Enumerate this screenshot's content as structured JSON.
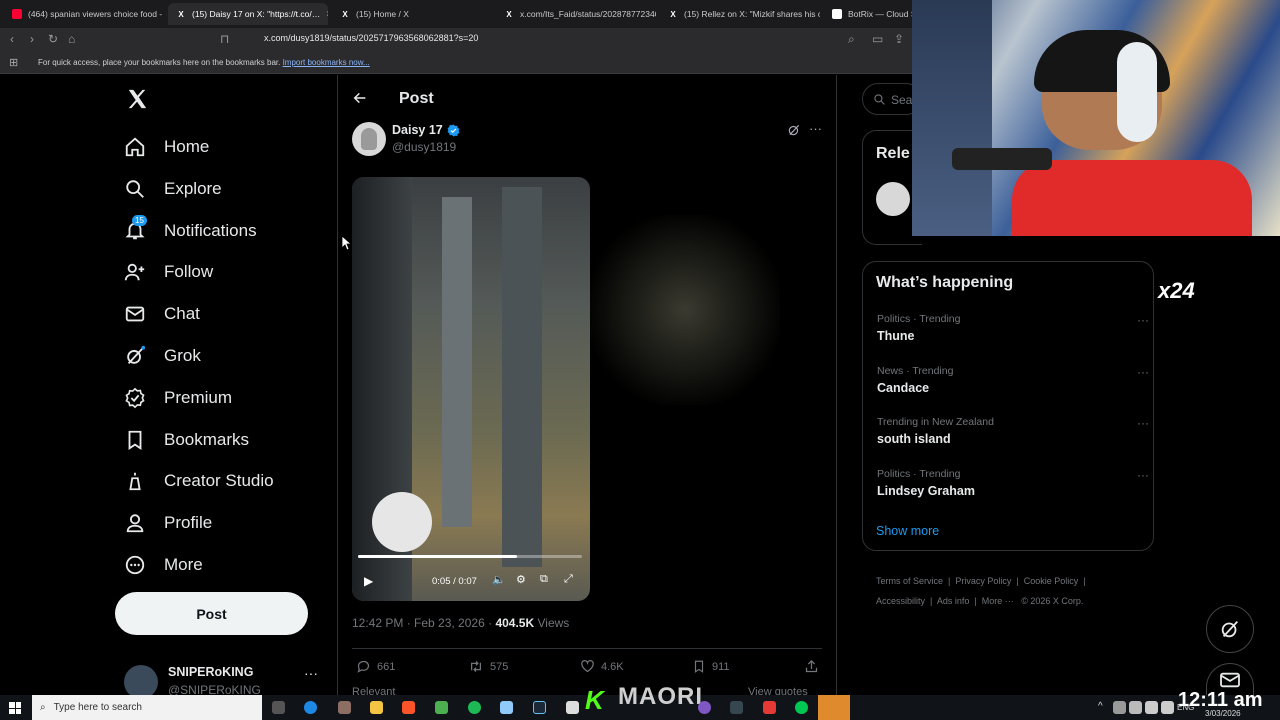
{
  "browser": {
    "tabs": [
      {
        "title": "(464) spanian viewers choice food - …",
        "fav_color": "#ff0033"
      },
      {
        "title": "(15) Daisy 17 on X: \"https://t.co/…",
        "fav_color": "#000000"
      },
      {
        "title": "(15) Home / X",
        "fav_color": "#000000"
      },
      {
        "title": "x.com/Its_Faid/status/202878772346…",
        "fav_color": "#000000"
      },
      {
        "title": "(15) Rellez on X: \"Mizkif shares his o…",
        "fav_color": "#000000"
      },
      {
        "title": "BotRix — Cloud St…",
        "fav_color": "#ffffff"
      }
    ],
    "close_glyph": "×",
    "url": "x.com/dusy1819/status/2025717963568062881?s=20",
    "bookmarks_hint": "For quick access, place your bookmarks here on the bookmarks bar.",
    "bookmarks_link": "Import bookmarks now..."
  },
  "sidebar": {
    "items": [
      {
        "label": "Home",
        "icon": "home-icon"
      },
      {
        "label": "Explore",
        "icon": "search-icon"
      },
      {
        "label": "Notifications",
        "icon": "bell-icon",
        "badge": "15"
      },
      {
        "label": "Follow",
        "icon": "follow-icon"
      },
      {
        "label": "Chat",
        "icon": "mail-icon"
      },
      {
        "label": "Grok",
        "icon": "grok-icon"
      },
      {
        "label": "Premium",
        "icon": "verified-icon"
      },
      {
        "label": "Bookmarks",
        "icon": "bookmark-icon"
      },
      {
        "label": "Creator Studio",
        "icon": "creator-icon"
      },
      {
        "label": "Profile",
        "icon": "person-icon"
      },
      {
        "label": "More",
        "icon": "more-icon"
      }
    ],
    "post_button": "Post",
    "account_name": "SNIPERoKING",
    "account_handle": "@SNIPERoKING"
  },
  "post": {
    "header": "Post",
    "author_name": "Daisy 17",
    "author_handle": "@dusy1819",
    "video_time": "0:05 / 0:07",
    "video_progress": 0.71,
    "timestamp": "12:42 PM · Feb 23, 2026 ·",
    "views": "404.5K",
    "views_label": "Views",
    "replies": "661",
    "reposts": "575",
    "likes": "4.6K",
    "bookmarks": "911",
    "sort_label": "Relevant",
    "view_quotes": "View quotes"
  },
  "right": {
    "search_placeholder": "Sear",
    "relevant_title": "Rele",
    "whats_happening": "What’s happening",
    "trends": [
      {
        "meta": "Politics · Trending",
        "name": "Thune"
      },
      {
        "meta": "News · Trending",
        "name": "Candace"
      },
      {
        "meta": "Trending in New Zealand",
        "name": "south island"
      },
      {
        "meta": "Politics · Trending",
        "name": "Lindsey Graham"
      }
    ],
    "show_more": "Show more",
    "footer": [
      "Terms of Service",
      "Privacy Policy",
      "Cookie Policy",
      "Accessibility",
      "Ads info",
      "More ···",
      "© 2026 X Corp."
    ]
  },
  "overlay": {
    "multiplier": "x24"
  },
  "taskbar": {
    "search_placeholder": "Type here to search",
    "brand_text": "MAORI",
    "time": "12:11 am",
    "date": "3/03/2026",
    "lang": "ENG"
  },
  "colors": {
    "accent": "#1d9bf0",
    "text": "#e7e9ea",
    "muted": "#71767b",
    "border": "#2f3336"
  }
}
